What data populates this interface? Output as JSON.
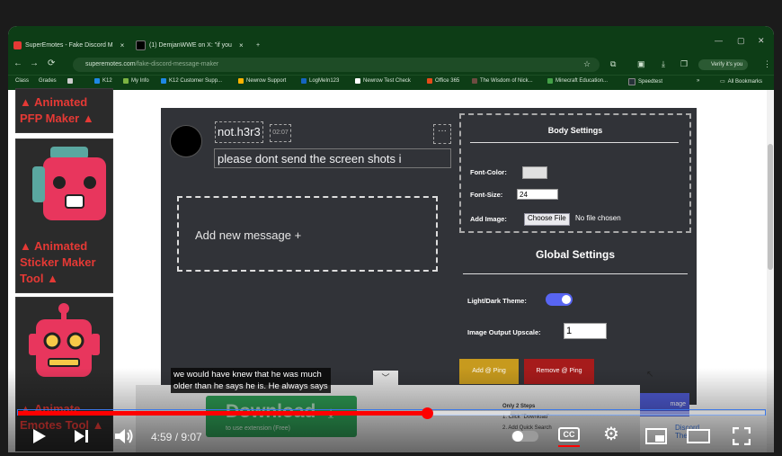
{
  "browser": {
    "tabs": [
      {
        "title": "SuperEmotes - Fake Discord M",
        "close": "×",
        "favicon_color": "#e53935"
      },
      {
        "title": "(1) DemjanWWE on X: \"if you",
        "close": "×",
        "favicon_color": "#000000"
      }
    ],
    "new_tab": "+",
    "window_controls": {
      "min": "—",
      "max": "▢",
      "close": "✕"
    },
    "url_host": "superemotes.com",
    "url_path": "/fake-discord-message-maker",
    "verify_label": "Verify it's you",
    "bookmarks": [
      {
        "label": "Class",
        "color": "#0d3d16"
      },
      {
        "label": "Grades",
        "color": "#0d3d16"
      },
      {
        "label": "",
        "color": "#cccccc"
      },
      {
        "label": "K12",
        "color": "#1e88e5"
      },
      {
        "label": "My Info",
        "color": "#7cb342"
      },
      {
        "label": "K12 Customer Supp...",
        "color": "#1e88e5"
      },
      {
        "label": "Newrow Support",
        "color": "#ffb300"
      },
      {
        "label": "LogMeIn123",
        "color": "#1565c0"
      },
      {
        "label": "Newrow Test Check",
        "color": "#ffffff"
      },
      {
        "label": "Office 365",
        "color": "#e64a19"
      },
      {
        "label": "The Wisdom of Nick...",
        "color": "#6d4c41"
      },
      {
        "label": "Minecraft Education...",
        "color": "#43a047"
      },
      {
        "label": "Speedtest",
        "color": "#263238"
      }
    ],
    "bookmarks_more": "»",
    "all_bookmarks": "All Bookmarks"
  },
  "sidebar": {
    "cards": [
      {
        "title": [
          "Animated",
          "PFP Maker"
        ]
      },
      {
        "title": [
          "Animated",
          "Sticker Maker",
          "Tool"
        ]
      },
      {
        "title": [
          "Animate",
          "Emotes Tool"
        ]
      }
    ]
  },
  "editor": {
    "username": "not.h3r3",
    "timestamp": "02:07",
    "more": "···",
    "message": "please dont send the screen shots i",
    "add_message": "Add new message +",
    "body_settings": {
      "title": "Body Settings",
      "font_color_label": "Font-Color:",
      "font_size_label": "Font-Size:",
      "font_size_value": "24",
      "add_image_label": "Add Image:",
      "choose_file": "Choose File",
      "no_file": "No file chosen"
    },
    "global_settings": {
      "title": "Global Settings",
      "theme_label": "Light/Dark Theme:",
      "theme_dark": true,
      "upscale_label": "Image Output Upscale:",
      "upscale_value": "1"
    },
    "add_ping": "Add @ Ping",
    "remove_ping": "Remove @ Ping",
    "image_button": "mage",
    "discord_label": "Discord The"
  },
  "download_popup": {
    "caret": "﹀",
    "download_label": "Download",
    "download_sub": "to use extension (Free)",
    "steps_title": "Only 2 Steps",
    "step1": "1. Click \"Download\"",
    "step2": "2. Add Quick Search"
  },
  "video": {
    "caption_line1": "we would have knew that he was much",
    "caption_line2": "older than he says he is. He always says",
    "current_time": "4:59",
    "duration": "9:07",
    "played_fraction": 0.547,
    "loaded_fraction": 0.66,
    "cc_label": "CC",
    "colors": {
      "played": "#ff0000"
    }
  }
}
